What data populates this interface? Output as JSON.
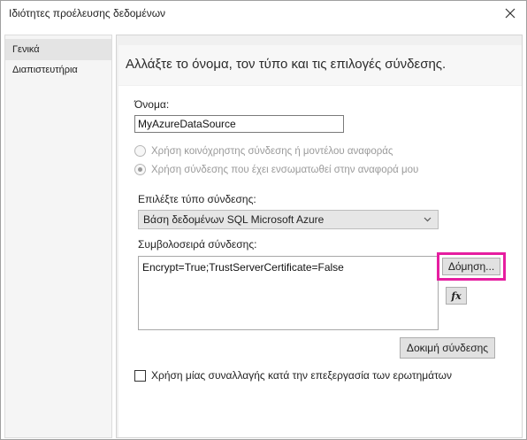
{
  "window": {
    "title": "Ιδιότητες προέλευσης δεδομένων",
    "close_icon": "close-icon"
  },
  "nav": {
    "items": [
      {
        "label": "Γενικά",
        "selected": true
      },
      {
        "label": "Διαπιστευτήρια",
        "selected": false
      }
    ]
  },
  "content": {
    "header": "Αλλάξτε το όνομα, τον τύπο και τις επιλογές σύνδεσης.",
    "name_label": "Όνομα:",
    "name_value": "MyAzureDataSource",
    "radio_shared": "Χρήση κοινόχρηστης σύνδεσης ή μοντέλου αναφοράς",
    "radio_embedded": "Χρήση σύνδεσης που έχει ενσωματωθεί στην αναφορά μου",
    "radio_selected": "embedded",
    "type_label": "Επιλέξτε τύπο σύνδεσης:",
    "type_value": "Βάση δεδομένων SQL Microsoft Azure",
    "conn_label": "Συμβολοσειρά σύνδεσης:",
    "conn_value": "Encrypt=True;TrustServerCertificate=False",
    "build_button": "Δόμηση...",
    "fx_button": "fx",
    "test_button": "Δοκιμή σύνδεσης",
    "transaction_checkbox": "Χρήση μίας συναλλαγής κατά την επεξεργασία των ερωτημάτων",
    "transaction_checked": false
  },
  "colors": {
    "highlight": "#e61ea0",
    "nav_selected": "#e4e4e4",
    "header_bg": "#f7f7f7"
  }
}
